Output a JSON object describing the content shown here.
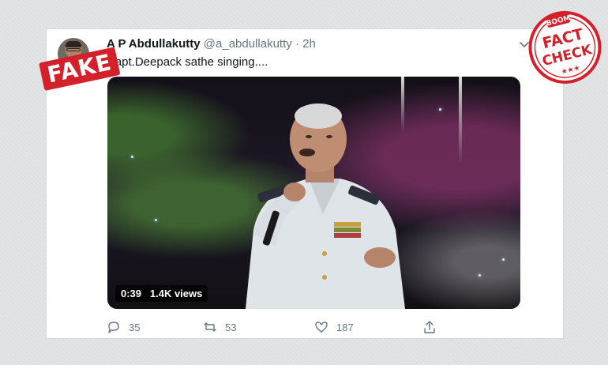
{
  "tweet": {
    "display_name": "A P Abdullakutty",
    "handle": "@a_abdullakutty",
    "separator": "·",
    "time": "2h",
    "text": "Capt.Deepack sathe singing....",
    "video": {
      "duration": "0:39",
      "views": "1.4K views"
    },
    "stats": {
      "replies": "35",
      "retweets": "53",
      "likes": "187"
    }
  },
  "stamps": {
    "fake_label": "FAKE",
    "fact_check": {
      "brand": "BOOM",
      "line1": "FACT",
      "line2": "CHECK",
      "stars": "★★★"
    }
  },
  "colors": {
    "fake_red": "#d4202a",
    "twitter_grey": "#657786",
    "text_dark": "#14171a"
  },
  "icons": [
    "chevron-down-icon",
    "reply-icon",
    "retweet-icon",
    "like-icon",
    "share-icon"
  ]
}
